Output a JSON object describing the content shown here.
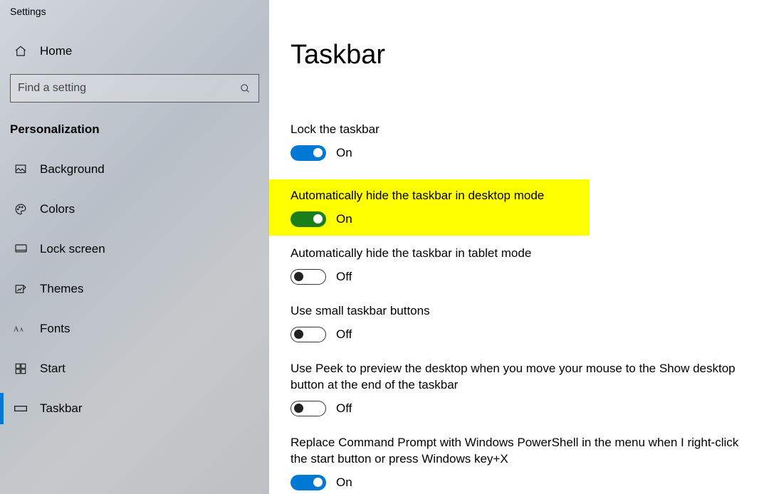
{
  "window_title": "Settings",
  "sidebar": {
    "home_label": "Home",
    "search_placeholder": "Find a setting",
    "section_label": "Personalization",
    "items": [
      {
        "icon": "background-icon",
        "label": "Background"
      },
      {
        "icon": "colors-icon",
        "label": "Colors"
      },
      {
        "icon": "lockscreen-icon",
        "label": "Lock screen"
      },
      {
        "icon": "themes-icon",
        "label": "Themes"
      },
      {
        "icon": "fonts-icon",
        "label": "Fonts"
      },
      {
        "icon": "start-icon",
        "label": "Start"
      },
      {
        "icon": "taskbar-icon",
        "label": "Taskbar"
      }
    ]
  },
  "main": {
    "title": "Taskbar",
    "settings": [
      {
        "label": "Lock the taskbar",
        "state_text": "On",
        "toggle": "on-blue",
        "highlight": false
      },
      {
        "label": "Automatically hide the taskbar in desktop mode",
        "state_text": "On",
        "toggle": "on-green",
        "highlight": true
      },
      {
        "label": "Automatically hide the taskbar in tablet mode",
        "state_text": "Off",
        "toggle": "off",
        "highlight": false
      },
      {
        "label": "Use small taskbar buttons",
        "state_text": "Off",
        "toggle": "off",
        "highlight": false
      },
      {
        "label": "Use Peek to preview the desktop when you move your mouse to the Show desktop button at the end of the taskbar",
        "state_text": "Off",
        "toggle": "off",
        "highlight": false
      },
      {
        "label": "Replace Command Prompt with Windows PowerShell in the menu when I right-click the start button or press Windows key+X",
        "state_text": "On",
        "toggle": "on-blue",
        "highlight": false
      }
    ]
  }
}
